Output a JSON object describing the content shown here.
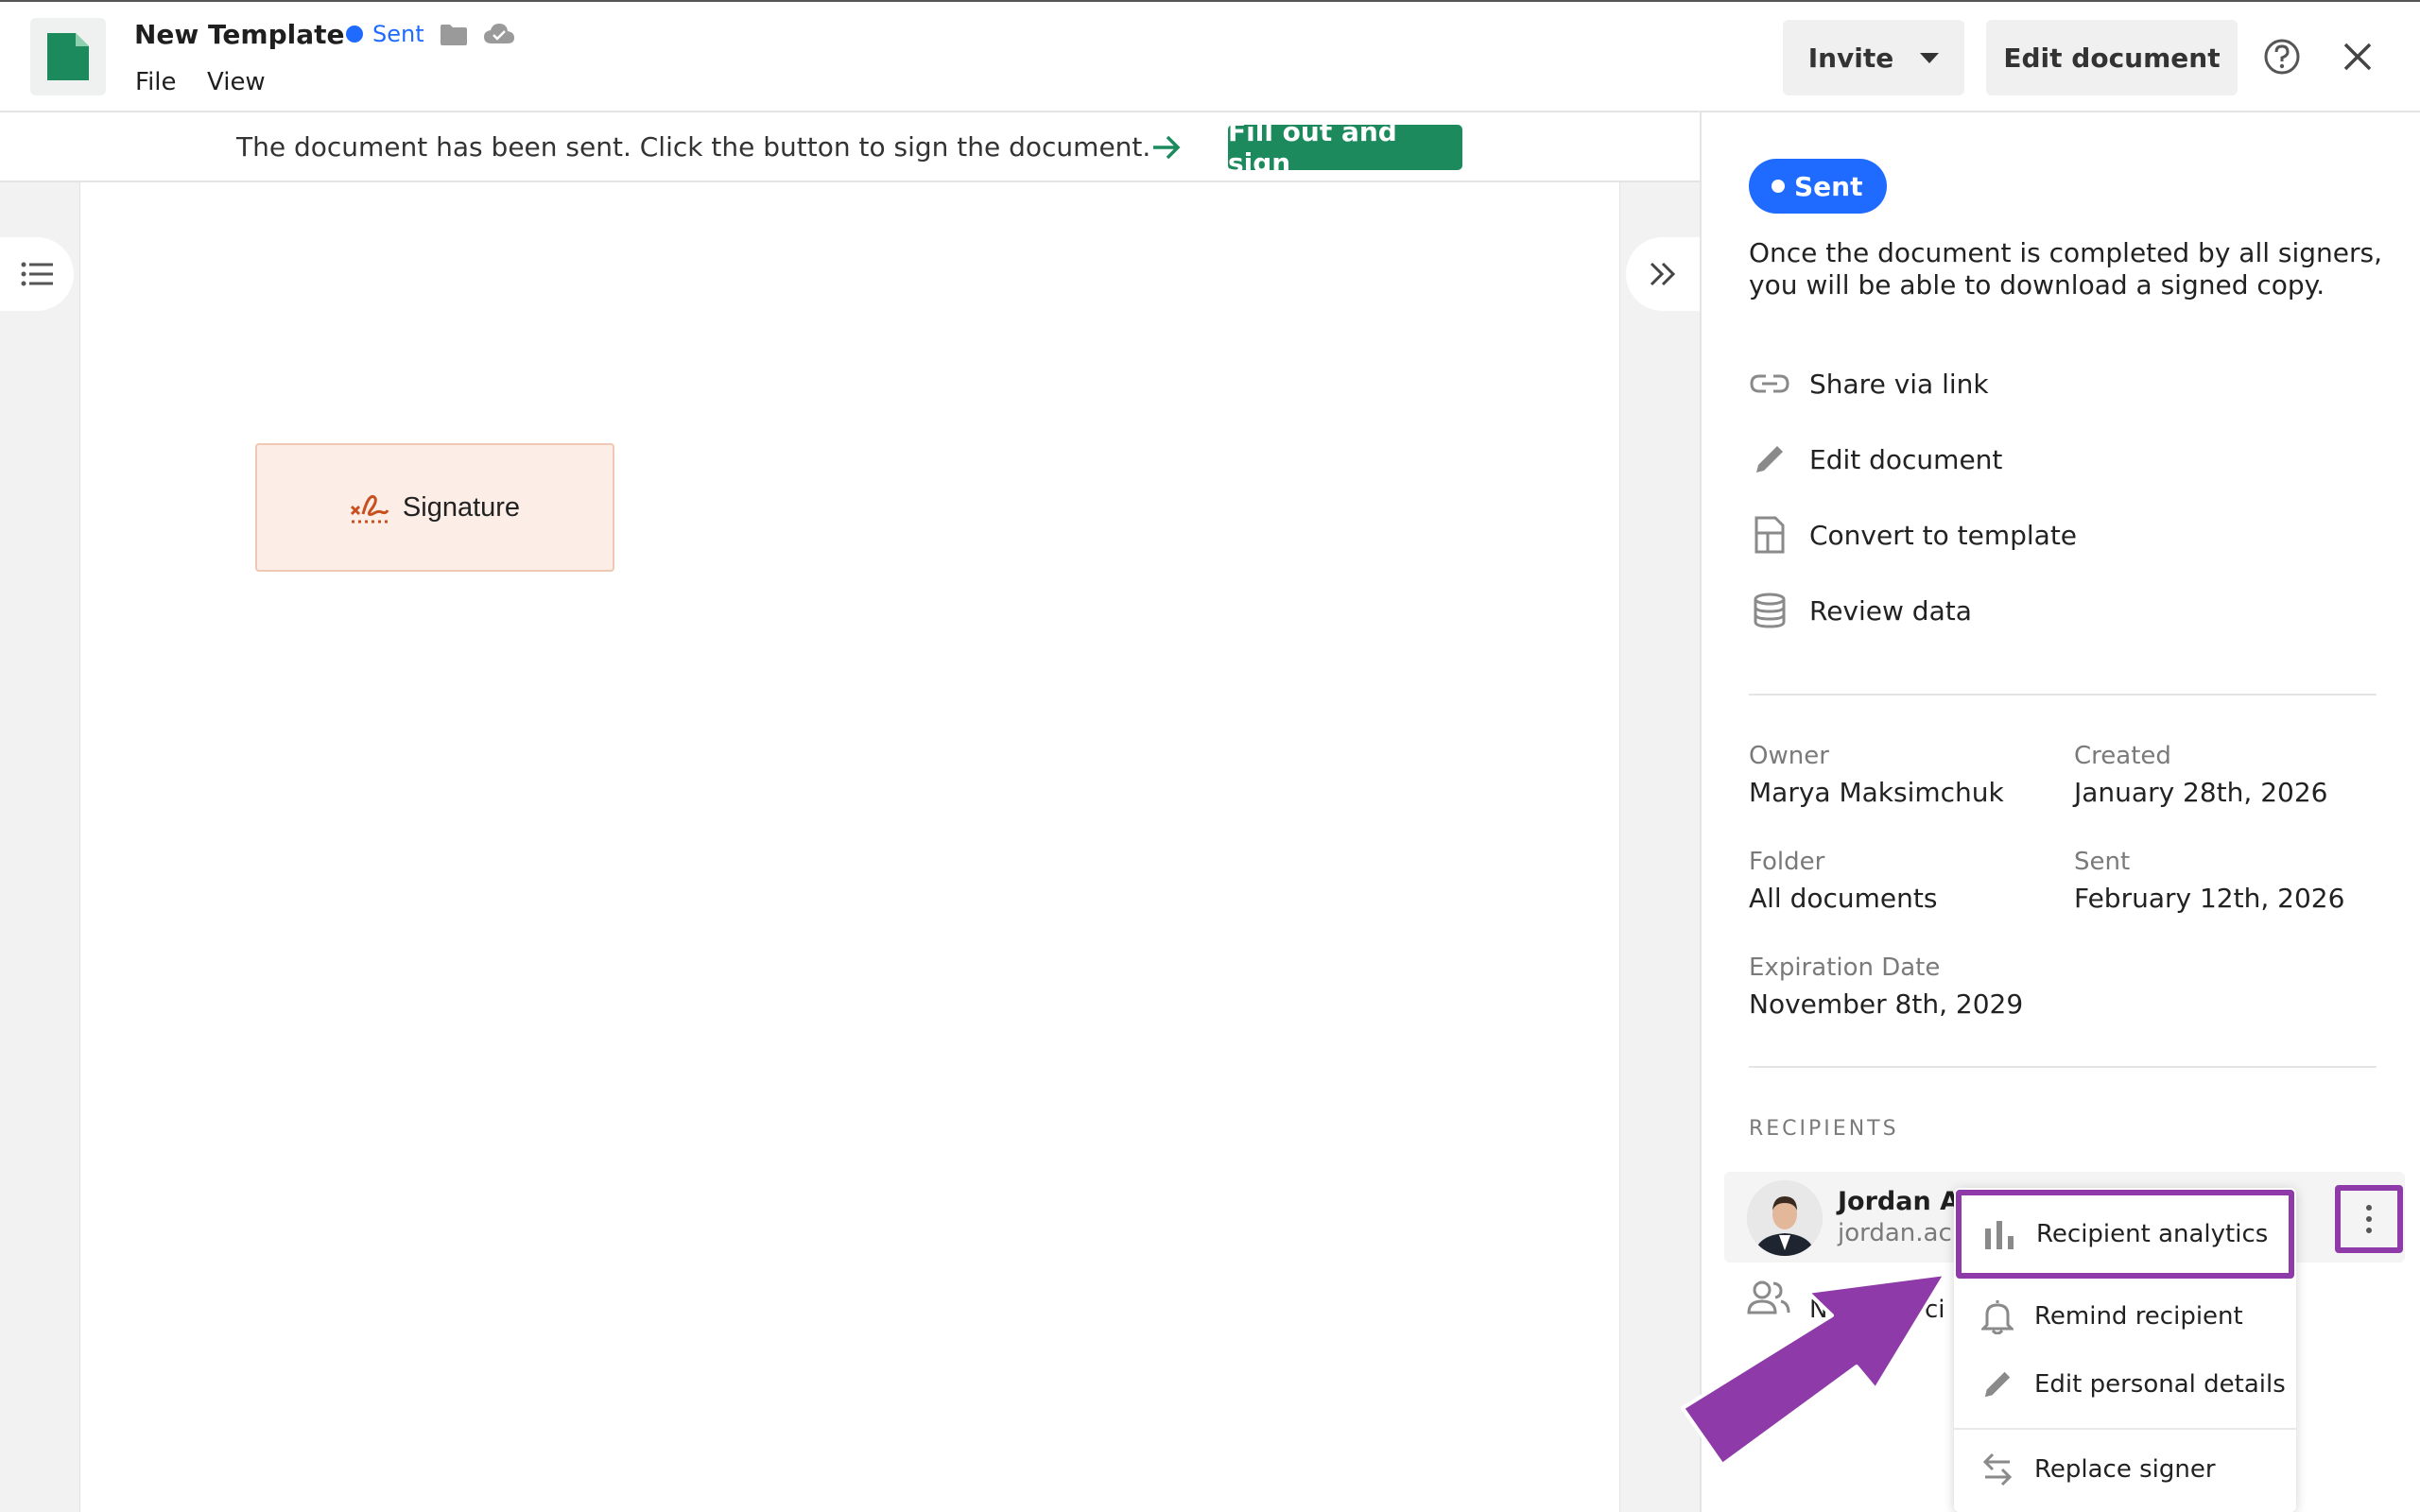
{
  "header": {
    "title": "New Template",
    "status": "Sent",
    "menu": {
      "file": "File",
      "view": "View"
    },
    "invite_label": "Invite",
    "edit_label": "Edit document"
  },
  "banner": {
    "text": "The document has been sent. Click the button to sign the document.",
    "button": "Fill out and sign"
  },
  "canvas": {
    "signature_label": "Signature"
  },
  "panel": {
    "status": "Sent",
    "note": "Once the document is completed by all signers, you will be able to download a signed copy.",
    "actions": [
      {
        "label": "Share via link",
        "icon": "link-icon"
      },
      {
        "label": "Edit document",
        "icon": "pencil-icon"
      },
      {
        "label": "Convert to template",
        "icon": "template-icon"
      },
      {
        "label": "Review data",
        "icon": "database-icon"
      }
    ],
    "meta": {
      "owner_label": "Owner",
      "owner": "Marya Maksimchuk",
      "created_label": "Created",
      "created": "January 28th, 2026",
      "folder_label": "Folder",
      "folder": "All documents",
      "sent_label": "Sent",
      "sent": "February 12th, 2026",
      "expiration_label": "Expiration Date",
      "expiration": "November 8th, 2029"
    },
    "recipients_title": "RECIPIENTS",
    "recipient": {
      "name": "Jordan A",
      "email": "jordan.ac"
    },
    "partial_row": {
      "a": "N",
      "b": "ci"
    }
  },
  "menu": {
    "items": [
      {
        "label": "Recipient analytics",
        "icon": "bar-chart-icon"
      },
      {
        "label": "Remind recipient",
        "icon": "bell-icon"
      },
      {
        "label": "Edit personal details",
        "icon": "pencil-icon"
      },
      {
        "label": "Replace signer",
        "icon": "swap-icon"
      }
    ]
  },
  "colors": {
    "brand_green": "#1c8a5c",
    "status_blue": "#1f6bff",
    "highlight_purple": "#8e3aa8",
    "signature_fill": "#fcede6"
  }
}
